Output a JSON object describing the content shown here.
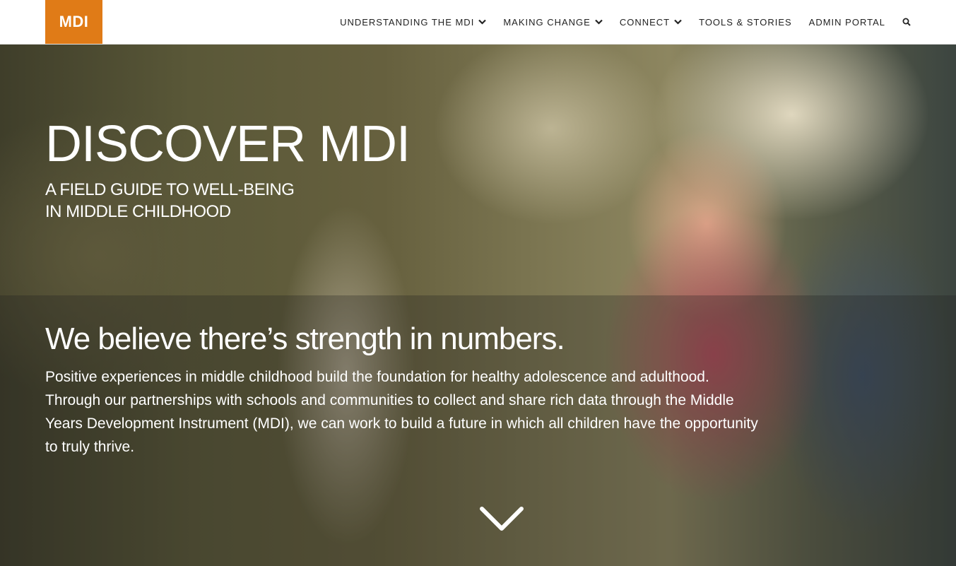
{
  "header": {
    "logo_text": "MDI",
    "nav": [
      {
        "label": "UNDERSTANDING THE MDI",
        "has_dropdown": true
      },
      {
        "label": "MAKING CHANGE",
        "has_dropdown": true
      },
      {
        "label": "CONNECT",
        "has_dropdown": true
      },
      {
        "label": "TOOLS & STORIES",
        "has_dropdown": false
      },
      {
        "label": "ADMIN PORTAL",
        "has_dropdown": false
      }
    ],
    "search_icon": "search-icon"
  },
  "hero": {
    "title": "DISCOVER MDI",
    "subtitle_line1": "A FIELD GUIDE TO WELL-BEING",
    "subtitle_line2": "IN MIDDLE CHILDHOOD",
    "headline": "We believe there’s strength in numbers.",
    "body": "Positive experiences in middle childhood build the foundation for healthy adolescence and adulthood. Through our partnerships with schools and communities to collect and share rich data through the Middle Years Development Instrument (MDI), we can work to build a future in which all children have the opportunity to truly thrive.",
    "scroll_icon": "chevron-down-icon"
  },
  "colors": {
    "brand_orange": "#e07b17",
    "nav_text": "#222222",
    "hero_text": "#ffffff"
  }
}
